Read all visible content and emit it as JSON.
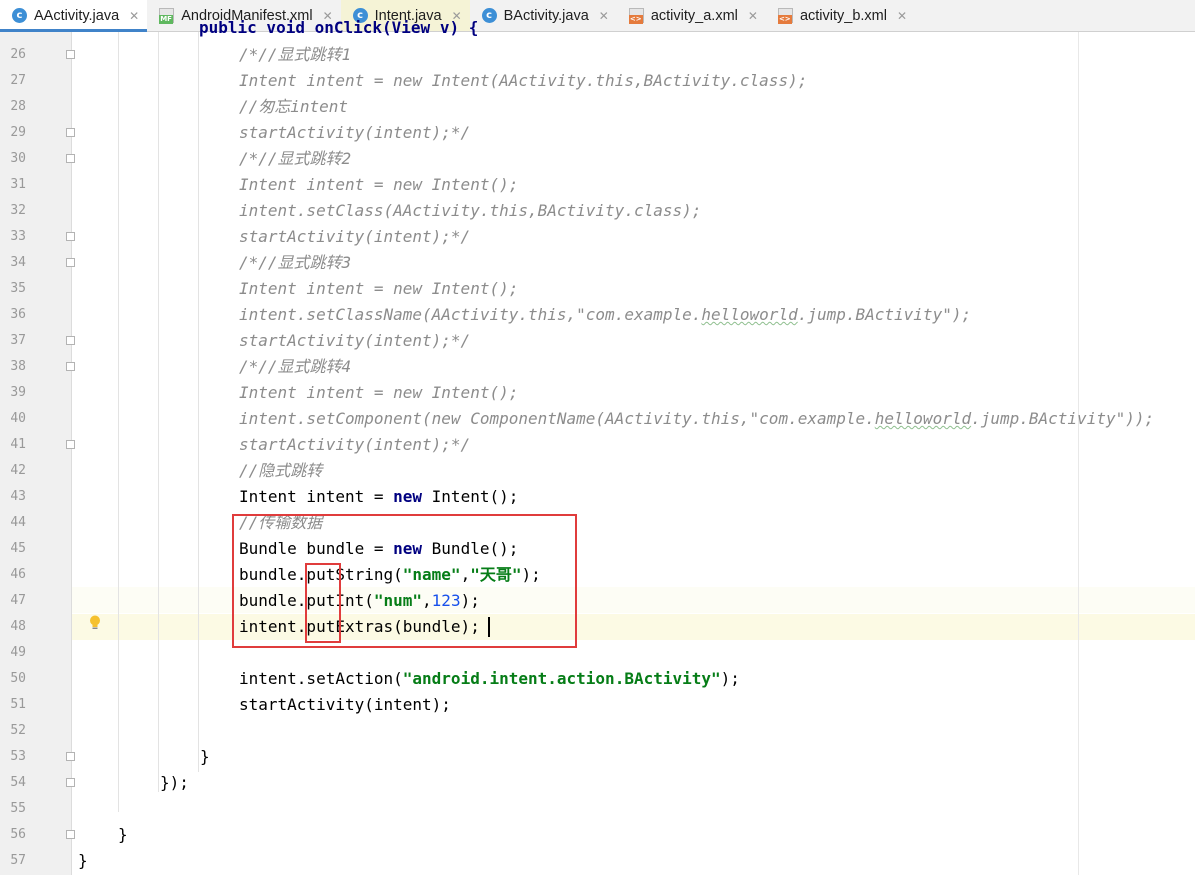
{
  "tabs": [
    {
      "label": "AActivity.java",
      "icon": "class-icon",
      "state": "active"
    },
    {
      "label": "AndroidManifest.xml",
      "icon": "manifest-icon",
      "state": "normal"
    },
    {
      "label": "Intent.java",
      "icon": "class-icon",
      "state": "modified"
    },
    {
      "label": "BActivity.java",
      "icon": "class-icon",
      "state": "normal"
    },
    {
      "label": "activity_a.xml",
      "icon": "xml-icon",
      "state": "normal"
    },
    {
      "label": "activity_b.xml",
      "icon": "xml-icon",
      "state": "normal"
    }
  ],
  "close_glyph": "✕",
  "lines": [
    {
      "n": "26",
      "text": "/*//显式跳转1"
    },
    {
      "n": "27",
      "text": "Intent intent = new Intent(AActivity.this,BActivity.class);"
    },
    {
      "n": "28",
      "text": "//匆忘intent"
    },
    {
      "n": "29",
      "text": "startActivity(intent);*/"
    },
    {
      "n": "30",
      "text": "/*//显式跳转2"
    },
    {
      "n": "31",
      "text": "Intent intent = new Intent();"
    },
    {
      "n": "32",
      "text": "intent.setClass(AActivity.this,BActivity.class);"
    },
    {
      "n": "33",
      "text": "startActivity(intent);*/"
    },
    {
      "n": "34",
      "text": "/*//显式跳转3"
    },
    {
      "n": "35",
      "text": "Intent intent = new Intent();"
    },
    {
      "n": "36",
      "text": "intent.setClassName(AActivity.this,\"com.example.helloworld.jump.BActivity\");"
    },
    {
      "n": "37",
      "text": "startActivity(intent);*/"
    },
    {
      "n": "38",
      "text": "/*//显式跳转4"
    },
    {
      "n": "39",
      "text": "Intent intent = new Intent();"
    },
    {
      "n": "40",
      "text": "intent.setComponent(new ComponentName(AActivity.this,\"com.example.helloworld.jump.BActivity\"));"
    },
    {
      "n": "41",
      "text": "startActivity(intent);*/"
    },
    {
      "n": "42",
      "text": "//隐式跳转"
    },
    {
      "n": "43",
      "text": "Intent intent = new Intent();"
    },
    {
      "n": "44",
      "text": "//传输数据"
    },
    {
      "n": "45",
      "text": "Bundle bundle = new Bundle();"
    },
    {
      "n": "46",
      "text": "bundle.putString(\"name\",\"天哥\");"
    },
    {
      "n": "47",
      "text": "bundle.putInt(\"num\",123);"
    },
    {
      "n": "48",
      "text": "intent.putExtras(bundle);"
    },
    {
      "n": "49",
      "text": ""
    },
    {
      "n": "50",
      "text": "intent.setAction(\"android.intent.action.BActivity\");"
    },
    {
      "n": "51",
      "text": "startActivity(intent);"
    },
    {
      "n": "52",
      "text": ""
    },
    {
      "n": "53",
      "text": "}"
    },
    {
      "n": "54",
      "text": "});"
    },
    {
      "n": "55",
      "text": ""
    },
    {
      "n": "56",
      "text": "}"
    },
    {
      "n": "57",
      "text": "}"
    }
  ],
  "top_partial": "public void onClick(View v) {"
}
